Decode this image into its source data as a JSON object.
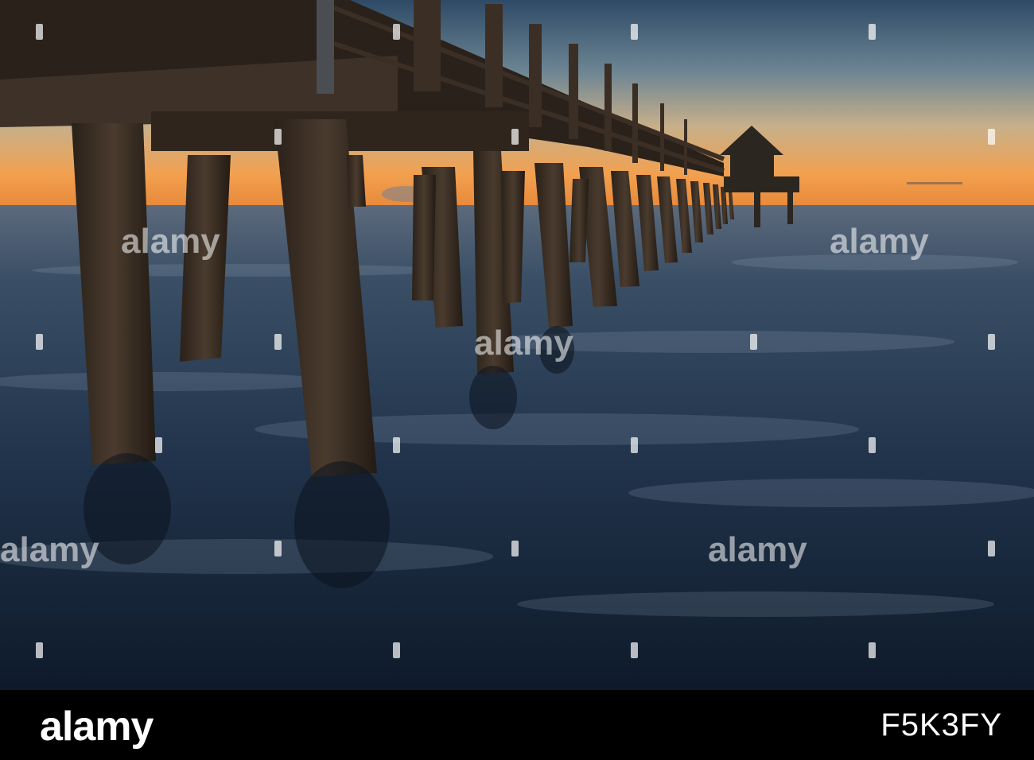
{
  "photo": {
    "subject": "pier",
    "colors": {
      "sky_top": "#2f4f6c",
      "sky_mid": "#8fa2a5",
      "horizon_glow": "#f39a4a",
      "water_dark": "#0d1826",
      "water_mid": "#2d4058",
      "wood": "#3d3026",
      "wood_dark": "#221a14"
    }
  },
  "watermark": {
    "text": "alamy"
  },
  "footer": {
    "logo": "alamy",
    "image_id": "F5K3FY"
  }
}
